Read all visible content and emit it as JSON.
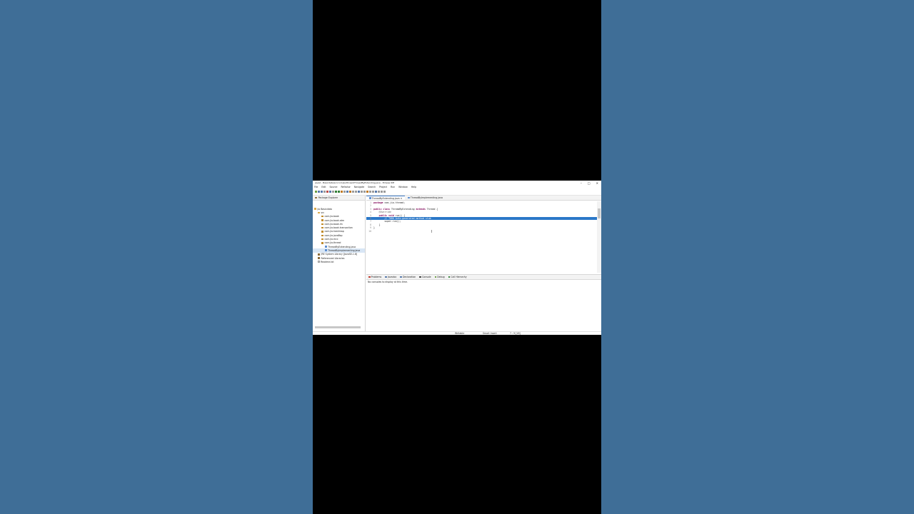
{
  "window": {
    "title": "java2 - Basicdata/src/com/jio/thread/ThreadByExtending.java - Eclipse IDE",
    "controls": {
      "minimize": "–",
      "maximize": "□",
      "close": "✕"
    }
  },
  "menu": [
    "File",
    "Edit",
    "Source",
    "Refactor",
    "Navigate",
    "Search",
    "Project",
    "Run",
    "Window",
    "Help"
  ],
  "package_explorer": {
    "title": "Package Explorer",
    "tree": [
      {
        "label": "jio Basicdata",
        "depth": 0,
        "icon": "project-icon"
      },
      {
        "label": "src",
        "depth": 1,
        "icon": "folder-icon"
      },
      {
        "label": "com.jio.book",
        "depth": 2,
        "icon": "package-icon"
      },
      {
        "label": "com.jio.book.atm",
        "depth": 2,
        "icon": "package-icon"
      },
      {
        "label": "com.jio.book.lm",
        "depth": 2,
        "icon": "package-icon"
      },
      {
        "label": "com.jio.book.transaction",
        "depth": 2,
        "icon": "package-icon"
      },
      {
        "label": "com.jio.hashmap",
        "depth": 2,
        "icon": "package-icon"
      },
      {
        "label": "com.jio.javaBsp",
        "depth": 2,
        "icon": "package-icon"
      },
      {
        "label": "com.jio.mcc",
        "depth": 2,
        "icon": "package-icon"
      },
      {
        "label": "com.jio.thread",
        "depth": 2,
        "icon": "package-icon"
      },
      {
        "label": "ThreadByExtending.java",
        "depth": 3,
        "icon": "java-file-icon"
      },
      {
        "label": "ThreadByImplementing.java",
        "depth": 3,
        "icon": "java-file-icon",
        "selected": true
      },
      {
        "label": "JRE System Library [JavaSE-1.8]",
        "depth": 1,
        "icon": "library-icon"
      },
      {
        "label": "Referenced Libraries",
        "depth": 1,
        "icon": "library-icon"
      },
      {
        "label": "Readme.txt",
        "depth": 1,
        "icon": "text-file-icon"
      }
    ]
  },
  "editor": {
    "tabs": [
      {
        "label": "ThreadByExtending.java",
        "active": true
      },
      {
        "label": "ThreadByImplementing.java",
        "active": false
      }
    ],
    "lines": [
      {
        "n": "1",
        "parts": [
          [
            "kw",
            "package"
          ],
          [
            "",
            " com.jio.thread;"
          ]
        ]
      },
      {
        "n": "2",
        "parts": []
      },
      {
        "n": "3",
        "parts": [
          [
            "kw",
            "public class"
          ],
          [
            "",
            " ThreadByExtending "
          ],
          [
            "kw",
            "extends"
          ],
          [
            "",
            " Thread {"
          ]
        ]
      },
      {
        "n": "4",
        "parts": [
          [
            "ann",
            "    @Override"
          ]
        ]
      },
      {
        "n": "5",
        "parts": [
          [
            "kw",
            "    public void"
          ],
          [
            "",
            " run() {"
          ]
        ]
      },
      {
        "n": "6",
        "parts": [
          [
            "cm",
            "        // TODO Auto-generated method stub"
          ]
        ],
        "hl": true
      },
      {
        "n": "7",
        "parts": [
          [
            "",
            "        super.run();"
          ]
        ]
      },
      {
        "n": "8",
        "parts": [
          [
            "",
            "    }"
          ]
        ]
      },
      {
        "n": "9",
        "parts": [
          [
            "",
            "}"
          ]
        ]
      },
      {
        "n": "10",
        "parts": []
      }
    ]
  },
  "bottom_panel": {
    "tabs": [
      "Problems",
      "Javadoc",
      "Declaration",
      "Console",
      "Debug",
      "Call Hierarchy"
    ],
    "message": "No consoles to display at this time."
  },
  "status": {
    "writable": "Writable",
    "insert": "Smart Insert",
    "position": "7 : 9 [18]"
  }
}
